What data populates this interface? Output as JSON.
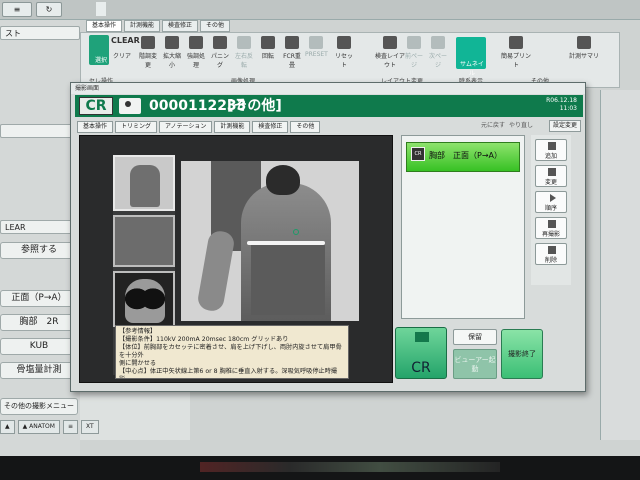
{
  "background": {
    "top_bar": {
      "list_label": "スト",
      "menu_label": "≡",
      "refresh_label": "↻"
    },
    "tabs": [
      "基本操作",
      "計測機能",
      "検査修正",
      "その他"
    ],
    "ribbon": {
      "select_label": "選択",
      "clear_label": "クリア",
      "clear_top": "CLEAR",
      "buttons": [
        "階調変更",
        "拡大縮小",
        "強調処理",
        "パニング",
        "左右反転",
        "回転",
        "FCR重畳",
        "PRESET",
        "リセット",
        "検査レイアウト",
        "前ページ",
        "次ページ",
        "サムネイル",
        "簡易プリント",
        "計測サマリ"
      ],
      "groups": [
        "セレ操作",
        "画像処理",
        "レイアウト変更",
        "時系表示",
        "その他"
      ]
    },
    "left": {
      "field_1": "",
      "clear_label": "LEAR",
      "ref_label": "参照する",
      "exam_buttons": [
        "正面（P→A）",
        "胸部　2R",
        "KUB",
        "骨塩量計測"
      ],
      "other_menu": "その他の撮影メニュー"
    },
    "bottom_tools": [
      "▲",
      "▲ ANATOM",
      "≡",
      "XT"
    ]
  },
  "dialog": {
    "title": "撮影画面",
    "logo": "CR",
    "patient_id": "0000112233",
    "exam_type": "[その他]",
    "date": "R06.12.18",
    "time": "11:03",
    "tabs": [
      "基本操作",
      "トリミング",
      "アノテーション",
      "計測機能",
      "検査修正",
      "その他"
    ],
    "undo": "元に戻す",
    "redo": "やり直し",
    "settings": "設定変更",
    "notes": [
      "【参考情報】",
      "【撮影条件】110kV 200mA 20msec 180cm グリッドあり",
      "【体位】前胸部をカセッテに密着させ、肩を上げ下げし、両肘内旋させて肩甲骨を十分外",
      "側に開かせる",
      "【中心点】体正中矢状線上第6 or 8 胸椎に垂直入射する。深吸気呼吸停止時撮",
      "影"
    ],
    "series_item": {
      "icon": "CR",
      "label": "胸部　正面（P→A）"
    },
    "side_buttons": [
      "追加",
      "変更",
      "順序",
      "再撮影",
      "削除"
    ],
    "actions": {
      "cr": "CR",
      "hold": "保留",
      "viewer": "ビューアー起動",
      "finish": "撮影終了"
    }
  }
}
